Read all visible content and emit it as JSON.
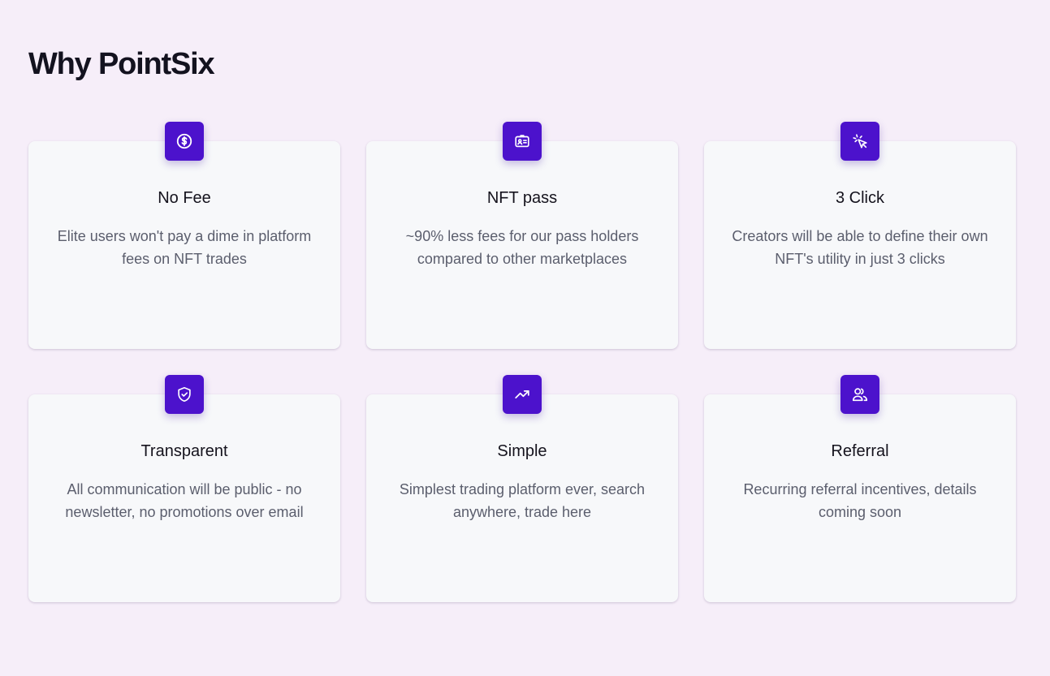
{
  "heading": "Why PointSix",
  "accent_color": "#4c12cc",
  "features": [
    {
      "icon": "dollar-circle-icon",
      "title": "No Fee",
      "description": "Elite users won't pay a dime in platform fees on NFT trades"
    },
    {
      "icon": "id-card-icon",
      "title": "NFT pass",
      "description": "~90% less fees for our pass holders compared to other marketplaces"
    },
    {
      "icon": "cursor-click-icon",
      "title": "3 Click",
      "description": "Creators will be able to define their own NFT's utility in just 3 clicks"
    },
    {
      "icon": "shield-check-icon",
      "title": "Transparent",
      "description": "All communication will be public - no newsletter, no promotions over email"
    },
    {
      "icon": "trending-up-icon",
      "title": "Simple",
      "description": "Simplest trading platform ever, search anywhere, trade here"
    },
    {
      "icon": "users-icon",
      "title": "Referral",
      "description": "Recurring referral incentives, details coming soon"
    }
  ]
}
